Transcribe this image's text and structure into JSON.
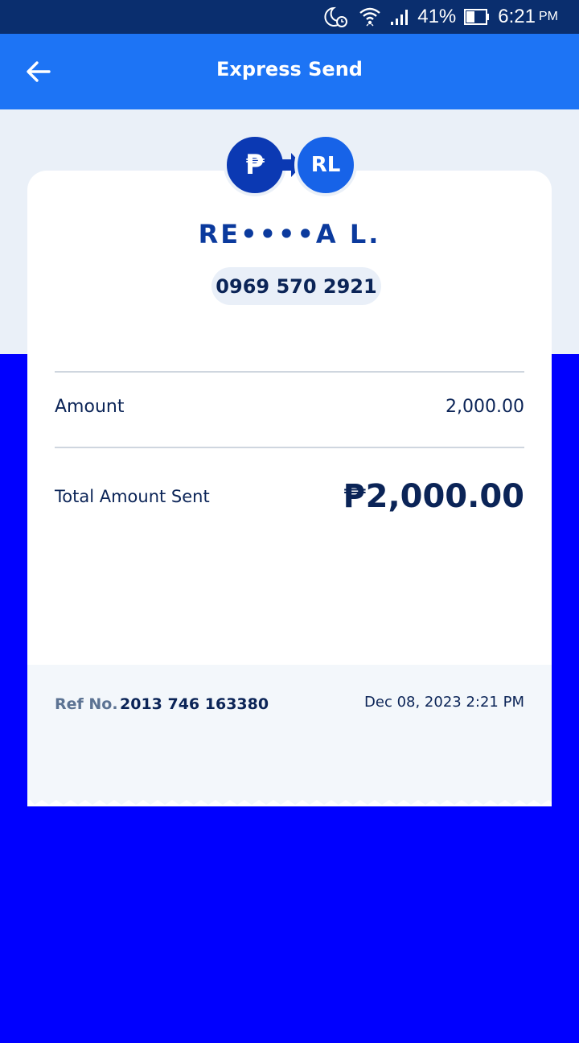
{
  "status_bar": {
    "battery": "41%",
    "time": "6:21",
    "ampm": "PM",
    "icons": [
      "moon-alarm-icon",
      "wifi-icon",
      "signal-icon",
      "battery-icon"
    ]
  },
  "header": {
    "title": "Express Send",
    "back_icon": "arrow-left-icon",
    "color": "#1d74f5"
  },
  "transfer": {
    "sender_avatar": "₱",
    "recipient_avatar": "RL",
    "recipient_name": "RE••••A L.",
    "recipient_phone": "0969 570 2921"
  },
  "details": {
    "amount_label": "Amount",
    "amount_value": "2,000.00",
    "total_label": "Total Amount Sent",
    "total_value": "₱2,000.00"
  },
  "reference": {
    "label": "Ref No.",
    "number": "2013 746 163380",
    "datetime": "Dec 08, 2023 2:21 PM"
  },
  "colors": {
    "page_bg": "#0000ff",
    "status_bar": "#0a2e6e",
    "accent_dark": "#0b39b3",
    "text_dark": "#0b2457"
  }
}
